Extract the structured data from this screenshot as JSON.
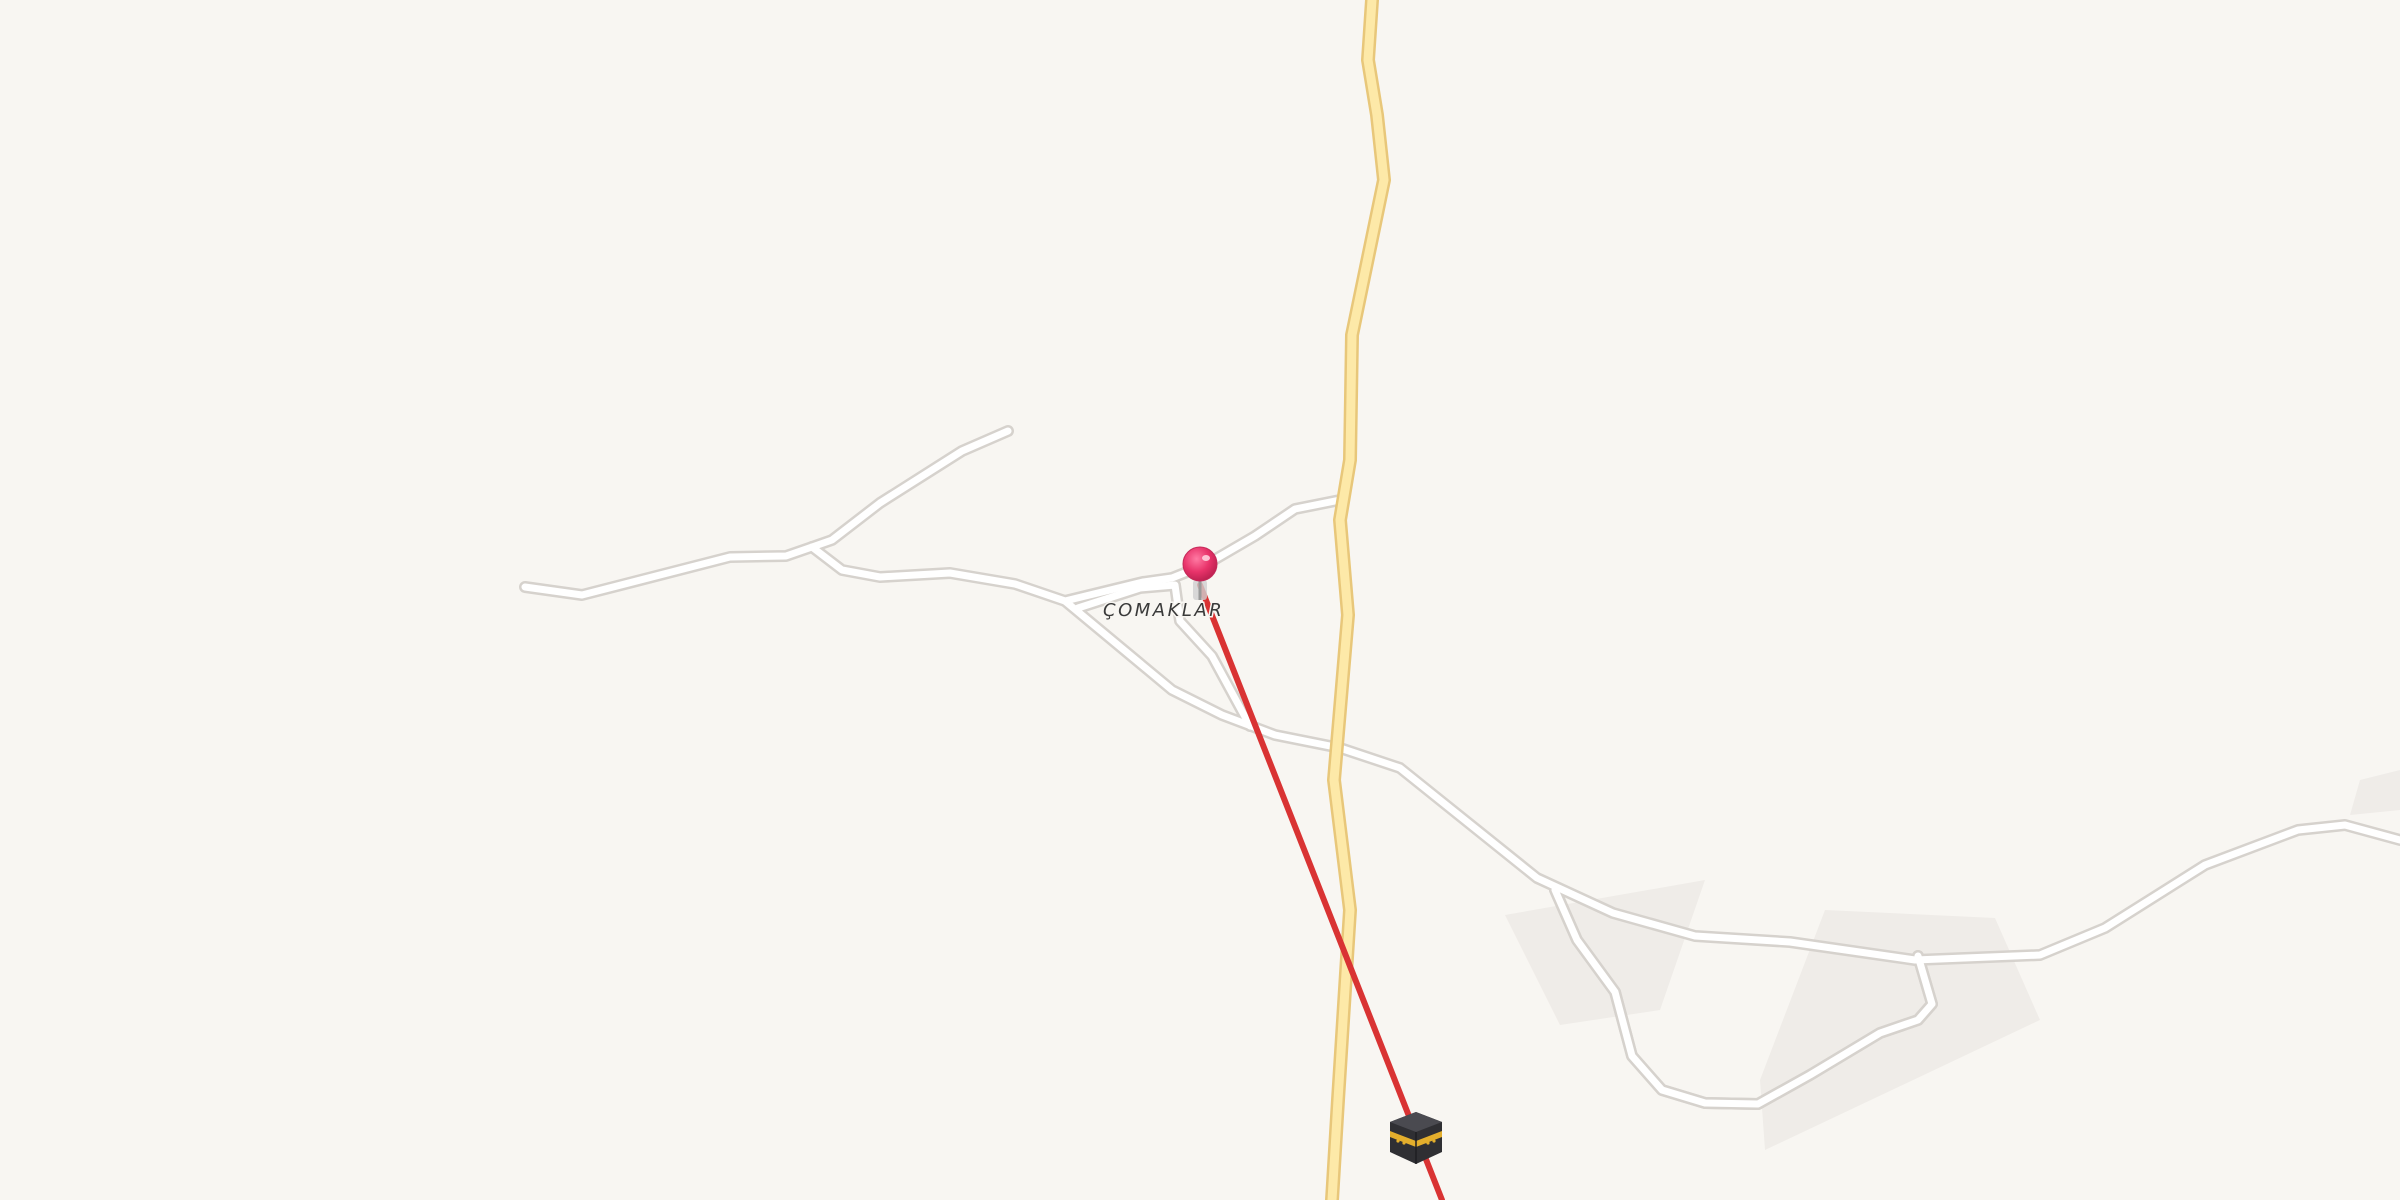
{
  "map": {
    "place_label": "ÇOMAKLAR",
    "colors": {
      "background": "#f8f6f2",
      "landuse": "#efece8",
      "minor_road_fill": "#ffffff",
      "minor_road_casing": "#d6d2cd",
      "highway_fill": "#fde9a8",
      "highway_casing": "#e8c77a",
      "route_line": "#d93333",
      "pin": "#e8336a"
    },
    "icons": {
      "pin": "map-pin-icon",
      "destination": "kaaba-icon"
    }
  }
}
